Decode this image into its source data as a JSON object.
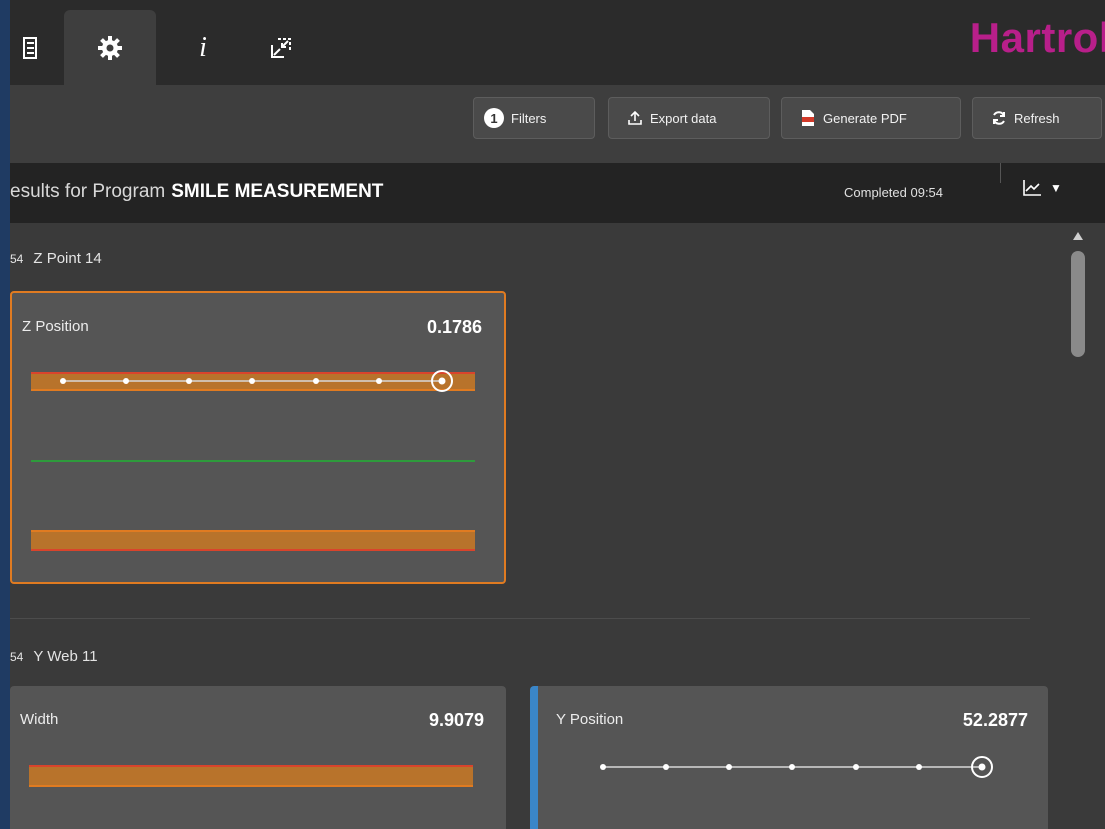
{
  "brand": {
    "name": "Hartrol"
  },
  "tabs": [
    {
      "id": "list",
      "icon": "list-icon",
      "active": false
    },
    {
      "id": "settings",
      "icon": "gear-icon",
      "active": true
    },
    {
      "id": "info",
      "icon": "info-icon",
      "label": "i",
      "active": false
    },
    {
      "id": "fullscreen",
      "icon": "collapse-icon",
      "active": false
    }
  ],
  "toolbar": {
    "filters_count": "1",
    "filters_label": "Filters",
    "export_label": "Export data",
    "pdf_label": "Generate PDF",
    "refresh_label": "Refresh"
  },
  "results": {
    "title_prefix": "esults for Program",
    "program": "SMILE MEASUREMENT",
    "status": "Completed 09:54",
    "view_icon": "line-chart-icon"
  },
  "groups": [
    {
      "prefix": "54",
      "name": "Z Point 14",
      "cards": [
        {
          "label": "Z Position",
          "value": "0.1786",
          "selected": true
        }
      ]
    },
    {
      "prefix": "54",
      "name": "Y Web 11",
      "cards": [
        {
          "label": "Width",
          "value": "9.9079",
          "selected": false
        },
        {
          "label": "Y Position",
          "value": "52.2877",
          "selected": false
        }
      ]
    }
  ],
  "colors": {
    "brand": "#b81f8a",
    "selected_border": "#e07b21",
    "tolerance_band": "#b8732b",
    "limit_line": "#d9442c",
    "nominal_line": "#2e9b3c",
    "accent": "#3a86c8"
  }
}
